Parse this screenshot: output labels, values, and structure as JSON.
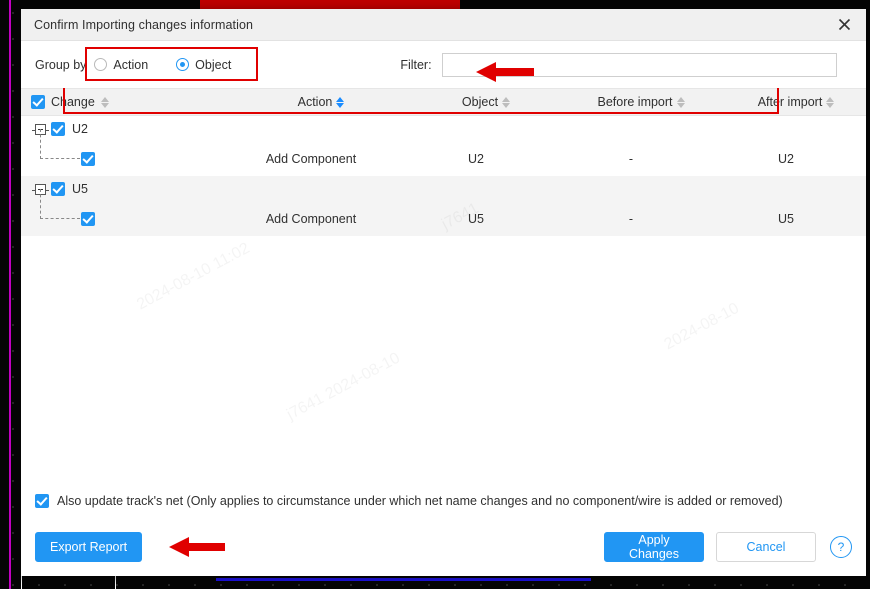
{
  "dialog": {
    "title": "Confirm Importing changes information",
    "close_icon": "close-icon"
  },
  "controls": {
    "group_by_label": "Group by",
    "options": [
      {
        "label": "Action",
        "selected": false
      },
      {
        "label": "Object",
        "selected": true
      }
    ],
    "filter_label": "Filter:",
    "filter_value": "",
    "filter_placeholder": ""
  },
  "table": {
    "columns": [
      {
        "label": "Change",
        "sorted": false
      },
      {
        "label": "Action",
        "sorted": true
      },
      {
        "label": "Object",
        "sorted": false
      },
      {
        "label": "Before import",
        "sorted": false
      },
      {
        "label": "After import",
        "sorted": false
      }
    ],
    "select_all_checked": true,
    "groups": [
      {
        "node": "U2",
        "checked": true,
        "expanded": true,
        "children": [
          {
            "checked": true,
            "action": "Add Component",
            "object": "U2",
            "before_import": "-",
            "after_import": "U2"
          }
        ]
      },
      {
        "node": "U5",
        "checked": true,
        "expanded": true,
        "children": [
          {
            "checked": true,
            "action": "Add Component",
            "object": "U5",
            "before_import": "-",
            "after_import": "U5"
          }
        ]
      }
    ]
  },
  "footer": {
    "track_net_checked": true,
    "track_net_label": "Also update track's net (Only applies to circumstance under which net name changes and no component/wire is added or removed)",
    "export_label": "Export Report",
    "apply_label": "Apply Changes",
    "cancel_label": "Cancel",
    "help_glyph": "?"
  },
  "watermarks": [
    "2024-08-10 11:02",
    "j7641",
    "2024-08-10",
    "11:02",
    "j7641 2024-08-10"
  ],
  "colors": {
    "accent": "#2196f3",
    "annotation": "#e00000",
    "title_bar": "#f0f0f0",
    "row_alt": "#f4f4f4",
    "pcb_trace_red": "#bf0000",
    "pcb_trace_blue": "#1f12ef",
    "pcb_magenta": "#c400c4"
  }
}
